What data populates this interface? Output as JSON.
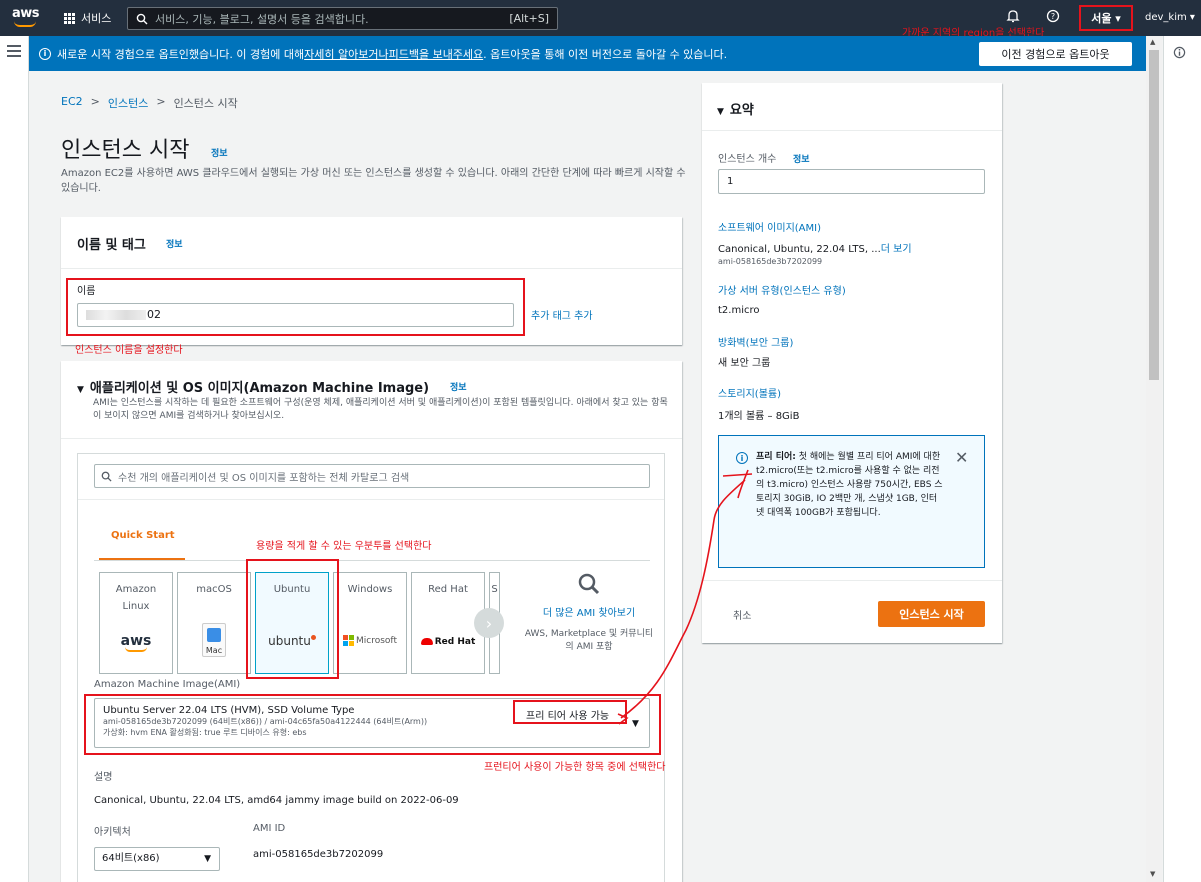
{
  "topnav": {
    "logo": "aws",
    "services": "서비스",
    "search_placeholder": "서비스, 기능, 블로그, 설명서 등을 검색합니다.",
    "search_shortcut": "[Alt+S]",
    "region": "서울 ▾",
    "user": "dev_kim ▾",
    "bell_icon": "bell-icon",
    "help_icon": "help-icon"
  },
  "banner": {
    "text_before": "새로운 시작 경험으로 옵트인했습니다. 이 경험에 대해 ",
    "link1": "자세히 알아보거나",
    "text_mid": " ",
    "link2": "피드백을 보내주세요",
    "text_after": ". 옵트아웃을 통해 이전 버전으로 돌아갈 수 있습니다.",
    "optout_button": "이전 경험으로 옵트아웃",
    "close": "✕"
  },
  "breadcrumb": [
    "EC2",
    "인스턴스",
    "인스턴스 시작"
  ],
  "page": {
    "title": "인스턴스 시작",
    "info": "정보",
    "description": "Amazon EC2를 사용하면 AWS 클라우드에서 실행되는 가상 머신 또는 인스턴스를 생성할 수 있습니다. 아래의 간단한 단계에 따라 빠르게 시작할 수 있습니다."
  },
  "name_section": {
    "title": "이름 및 태그",
    "info": "정보",
    "name_label": "이름",
    "name_value_suffix": "02",
    "add_tag": "추가 태그 추가"
  },
  "ami_section": {
    "title": "애플리케이션 및 OS 이미지(Amazon Machine Image)",
    "info": "정보",
    "description": "AMI는 인스턴스를 시작하는 데 필요한 소프트웨어 구성(운영 체제, 애플리케이션 서버 및 애플리케이션)이 포함된 템플릿입니다. 아래에서 찾고 있는 항목이 보이지 않으면 AMI를 검색하거나 찾아보십시오.",
    "search_placeholder": "수천 개의 애플리케이션 및 OS 이미지를 포함하는 전체 카탈로그 검색",
    "tab": "Quick Start",
    "tiles": [
      {
        "name": "Amazon Linux",
        "logo": "aws"
      },
      {
        "name": "macOS",
        "logo": "Mac"
      },
      {
        "name": "Ubuntu",
        "logo": "ubuntu"
      },
      {
        "name": "Windows",
        "logo": "Microsoft"
      },
      {
        "name": "Red Hat",
        "logo": "Red Hat"
      },
      {
        "name": "S",
        "logo": ""
      }
    ],
    "more_ami": "더 많은 AMI 찾아보기",
    "more_ami_sub": "AWS, Marketplace 및 커뮤니티의 AMI 포함",
    "ami_label": "Amazon Machine Image(AMI)",
    "ami_title": "Ubuntu Server 22.04 LTS (HVM), SSD Volume Type",
    "ami_ids": "ami-058165de3b7202099 (64비트(x86)) / ami-04c65fa50a4122444 (64비트(Arm))",
    "ami_meta": "가상화: hvm     ENA 활성화됨: true     루트 디바이스 유형: ebs",
    "free_tier": "프리 티어 사용 가능",
    "desc_label": "설명",
    "desc_value": "Canonical, Ubuntu, 22.04 LTS, amd64 jammy image build on 2022-06-09",
    "arch_label": "아키텍처",
    "arch_value": "64비트(x86)",
    "amiid_label": "AMI ID",
    "amiid_value": "ami-058165de3b7202099"
  },
  "summary": {
    "title": "요약",
    "count_label": "인스턴스 개수",
    "count_info": "정보",
    "count_value": "1",
    "ami_label": "소프트웨어 이미지(AMI)",
    "ami_value": "Canonical, Ubuntu, 22.04 LTS, ...",
    "ami_more": "더 보기",
    "ami_id": "ami-058165de3b7202099",
    "type_label": "가상 서버 유형(인스턴스 유형)",
    "type_value": "t2.micro",
    "fw_label": "방화벽(보안 그룹)",
    "fw_value": "새 보안 그룹",
    "storage_label": "스토리지(볼륨)",
    "storage_value": "1개의 볼륨 – 8GiB",
    "free_tier_bold": "프리 티어:",
    "free_tier_text": " 첫 해에는 월별 프리 티어 AMI에 대한 t2.micro(또는 t2.micro를 사용할 수 없는 리전의 t3.micro) 인스턴스 사용량 750시간, EBS 스토리지 30GiB, IO 2백만 개, 스냅샷 1GB, 인터넷 대역폭 100GB가 포함됩니다.",
    "cancel": "취소",
    "launch": "인스턴스 시작"
  },
  "annotations": {
    "region_note": "가까운 지역의 region을 선택한다",
    "name_note": "인스턴스 이름을 설정한다",
    "ubuntu_note": "용량을 적게 할 수 있는 우분투를 선택한다",
    "freetier_note": "프런티어 사용이 가능한 항목 중에 선택한다"
  },
  "colors": {
    "nav_bg": "#232f3e",
    "banner_bg": "#0073bb",
    "accent": "#ec7211",
    "link": "#0073bb",
    "annotation": "#e5131c"
  }
}
